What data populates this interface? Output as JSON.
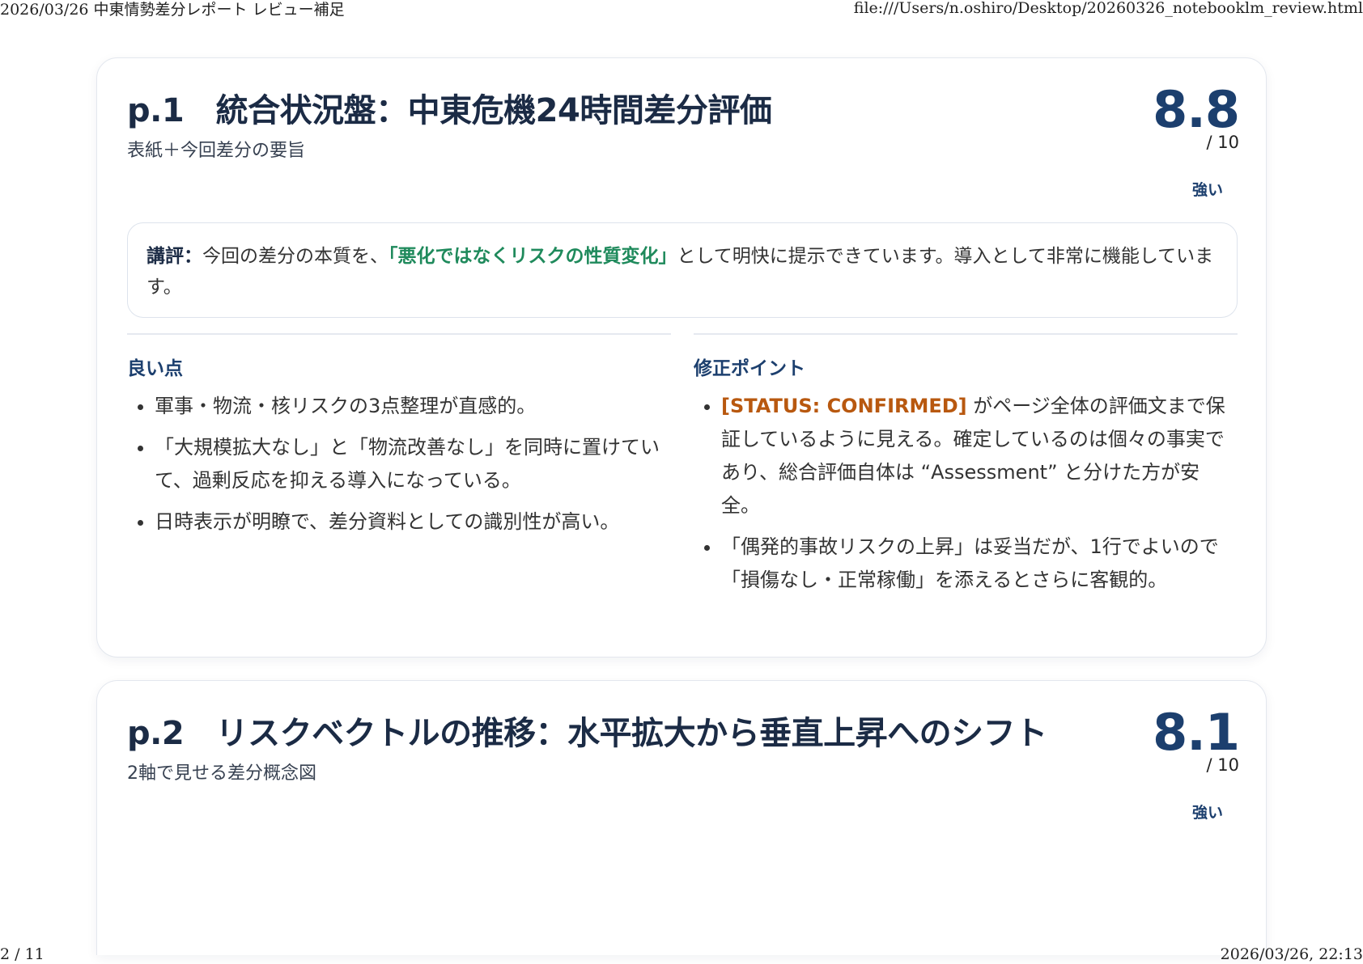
{
  "print_header": {
    "left": "2026/03/26 中東情勢差分レポート レビュー補足",
    "right": "file:///Users/n.oshiro/Desktop/20260326_notebooklm_review.html"
  },
  "print_footer": {
    "page": "2 / 11",
    "datetime": "2026/03/26, 22:13"
  },
  "cards": [
    {
      "title": "p.1　統合状況盤：中東危機24時間差分評価",
      "subtitle": "表紙＋今回差分の要旨",
      "score": "8.8",
      "score_max": "/ 10",
      "verdict": "強い",
      "comment": {
        "label": "講評：",
        "before": "今回の差分の本質を、",
        "highlight": "「悪化ではなくリスクの性質変化」",
        "after": "として明快に提示できています。導入として非常に機能しています。"
      },
      "good": {
        "heading": "良い点",
        "items": [
          "軍事・物流・核リスクの3点整理が直感的。",
          "「大規模拡大なし」と「物流改善なし」を同時に置けていて、過剰反応を抑える導入になっている。",
          "日時表示が明瞭で、差分資料としての識別性が高い。"
        ]
      },
      "fix": {
        "heading": "修正ポイント",
        "items": [
          {
            "tag": "[STATUS: CONFIRMED]",
            "text": " がページ全体の評価文まで保証しているように見える。確定しているのは個々の事実であり、総合評価自体は “Assessment” と分けた方が安全。"
          },
          {
            "tag": "",
            "text": "「偶発的事故リスクの上昇」は妥当だが、1行でよいので「損傷なし・正常稼働」を添えるとさらに客観的。"
          }
        ]
      }
    },
    {
      "title": "p.2　リスクベクトルの推移：水平拡大から垂直上昇へのシフト",
      "subtitle": "2軸で見せる差分概念図",
      "score": "8.1",
      "score_max": "/ 10",
      "verdict": "強い"
    }
  ]
}
